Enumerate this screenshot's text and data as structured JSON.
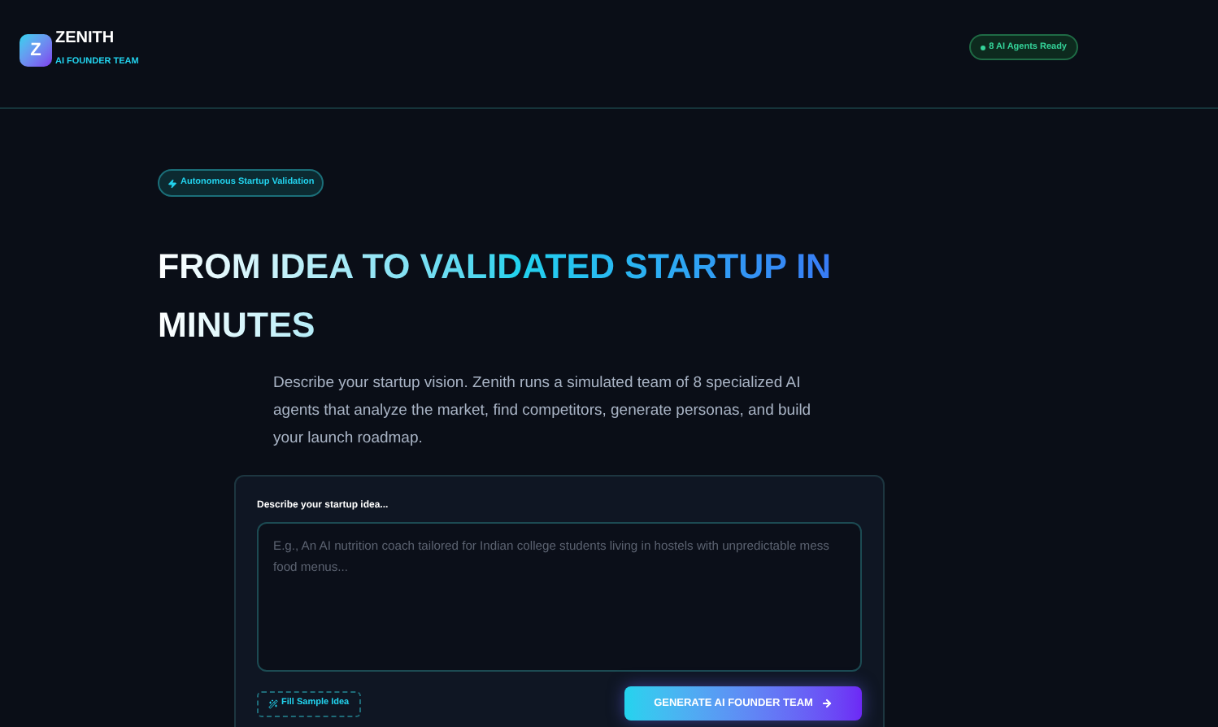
{
  "brand": {
    "logo": "Z",
    "name": "ZENITH",
    "tagline": "AI FOUNDER TEAM"
  },
  "status_badge": {
    "text": "8 AI Agents Ready"
  },
  "hero": {
    "badge": "Autonomous Startup Validation",
    "title": "FROM IDEA TO VALIDATED STARTUP IN MINUTES",
    "description": "Describe your startup vision. Zenith runs a simulated team of 8 specialized AI agents that analyze the market, find competitors, generate personas, and build your launch roadmap."
  },
  "form": {
    "label": "Describe your startup idea...",
    "placeholder": "E.g., An AI nutrition coach tailored for Indian college students living in hostels with unpredictable mess food menus...",
    "sample_button": "Fill Sample Idea",
    "submit_button": "GENERATE AI FOUNDER TEAM"
  }
}
